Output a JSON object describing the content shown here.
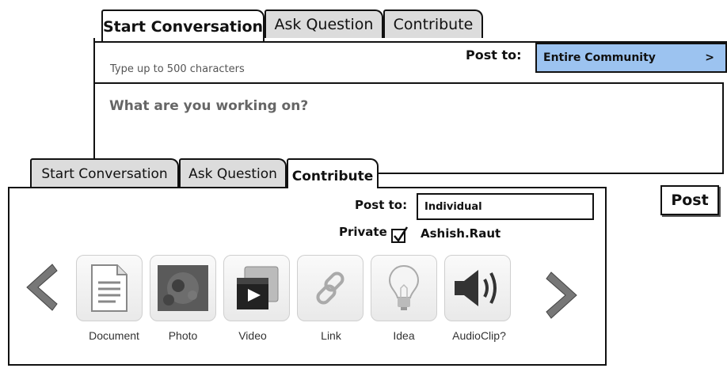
{
  "back_panel": {
    "tabs": [
      {
        "label": "Start Conversation",
        "active": true
      },
      {
        "label": "Ask Question",
        "active": false
      },
      {
        "label": "Contribute",
        "active": false
      }
    ],
    "hint": "Type up to 500 characters",
    "post_to_label": "Post to:",
    "post_to_value": "Entire Community",
    "chevron": ">",
    "textarea_placeholder": "What are you working on?",
    "post_button": "Post"
  },
  "front_panel": {
    "tabs": [
      {
        "label": "Start Conversation",
        "active": false
      },
      {
        "label": "Ask Question",
        "active": false
      },
      {
        "label": "Contribute",
        "active": true
      }
    ],
    "post_to_label": "Post to:",
    "post_to_value": "Individual",
    "private_label": "Private",
    "private_checked": true,
    "user_name": "Ashish.Raut",
    "carousel": [
      {
        "label": "Document",
        "icon": "document-icon"
      },
      {
        "label": "Photo",
        "icon": "photo-icon"
      },
      {
        "label": "Video",
        "icon": "video-icon"
      },
      {
        "label": "Link",
        "icon": "link-icon"
      },
      {
        "label": "Idea",
        "icon": "lightbulb-icon"
      },
      {
        "label": "AudioClip?",
        "icon": "speaker-icon"
      }
    ]
  },
  "colors": {
    "dropdown_blue": "#9cc3f0",
    "tile_bg": "#efefef"
  }
}
